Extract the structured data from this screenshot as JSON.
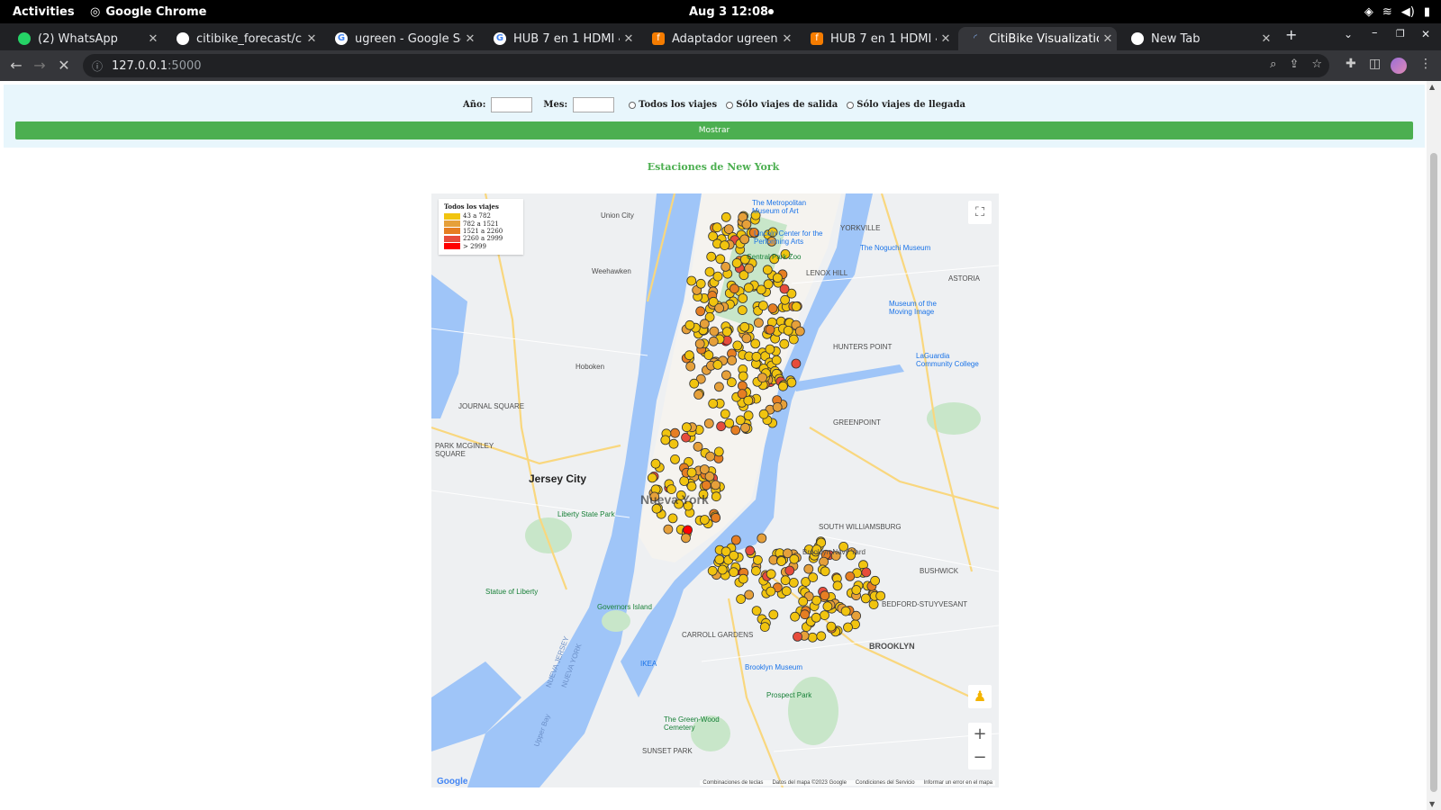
{
  "system": {
    "activities": "Activities",
    "app_name": "Google Chrome",
    "clock": "Aug 3  12:08"
  },
  "tabs": [
    {
      "title": "(2) WhatsApp",
      "favicon": "whatsapp-icon",
      "color": "#25d366"
    },
    {
      "title": "citibike_forecast/citib",
      "favicon": "github-icon",
      "color": "#ffffff"
    },
    {
      "title": "ugreen - Google Sear",
      "favicon": "google-icon",
      "color": "#ffffff"
    },
    {
      "title": "HUB 7 en 1 HDMI 4k",
      "favicon": "google-icon",
      "color": "#ffffff"
    },
    {
      "title": "Adaptador ugreen 6e",
      "favicon": "store-icon",
      "color": "#f57c00"
    },
    {
      "title": "HUB 7 en 1 HDMI 4k",
      "favicon": "store-icon",
      "color": "#f57c00"
    },
    {
      "title": "CitiBike Visualization",
      "favicon": "loading-icon",
      "color": "#8ab4f8"
    },
    {
      "title": "New Tab",
      "favicon": "chrome-icon",
      "color": "#ffffff"
    }
  ],
  "address": {
    "host": "127.0.0.1",
    "port": ":5000"
  },
  "form": {
    "year_label": "Año:",
    "month_label": "Mes:",
    "year_value": "",
    "month_value": "",
    "radio_all": "Todos los viajes",
    "radio_out": "Sólo viajes de salida",
    "radio_in": "Sólo viajes de llegada",
    "submit_label": "Mostrar"
  },
  "heading": "Estaciones de New York",
  "legend": {
    "title": "Todos los viajes",
    "items": [
      {
        "label": "43 a 782",
        "color": "#f1c40f"
      },
      {
        "label": "782 a 1521",
        "color": "#e6a03a"
      },
      {
        "label": "1521 a 2260",
        "color": "#e67e22"
      },
      {
        "label": "2260 a 2999",
        "color": "#e74c3c"
      },
      {
        "label": "> 2999",
        "color": "#ff0000"
      }
    ]
  },
  "map_labels": {
    "union_city": "Union City",
    "weehawken": "Weehawken",
    "hoboken": "Hoboken",
    "jersey_city": "Jersey City",
    "new_york": "Nueva York",
    "brooklyn": "BROOKLYN",
    "astoria": "ASTORIA",
    "yorkville": "YORKVILLE",
    "lenox_hill": "LENOX HILL",
    "hunters_point": "HUNTERS POINT",
    "greenpoint": "GREENPOINT",
    "south_williamsburg": "SOUTH WILLIAMSBURG",
    "bedford_stuyvesant": "BEDFORD-STUYVESANT",
    "carroll_gardens": "CARROLL GARDENS",
    "sunset_park": "SUNSET PARK",
    "bushwick": "BUSHWICK",
    "journal_square": "JOURNAL SQUARE",
    "park_mcginley": "PARK MCGINLEY SQUARE",
    "governors_island": "Governors Island",
    "statue_of_liberty": "Statue of Liberty",
    "liberty_state_park": "Liberty State Park",
    "prospect_park": "Prospect Park",
    "brooklyn_navy_yard": "Brooklyn Navy Yard",
    "metropolitan_museum": "The Metropolitan Museum of Art",
    "lincoln_center": "Lincoln Center for the Performing Arts",
    "central_park_zoo": "Central Park Zoo",
    "noguchi": "The Noguchi Museum",
    "laguardia_cc": "LaGuardia Community College",
    "museum_moving_image": "Museum of the Moving Image",
    "brooklyn_museum": "Brooklyn Museum",
    "green_wood": "The Green-Wood Cemetery",
    "ikea": "IKEA",
    "upper_bay": "Upper Bay",
    "nueva_jersey": "NUEVA JERSEY",
    "nueva_york_state": "NUEVA YORK"
  },
  "map_footer": {
    "shortcuts": "Combinaciones de teclas",
    "mapdata": "Datos del mapa ©2023 Google",
    "terms": "Condiciones del Servicio",
    "report": "Informar un error en el mapa",
    "logo": "Google"
  }
}
